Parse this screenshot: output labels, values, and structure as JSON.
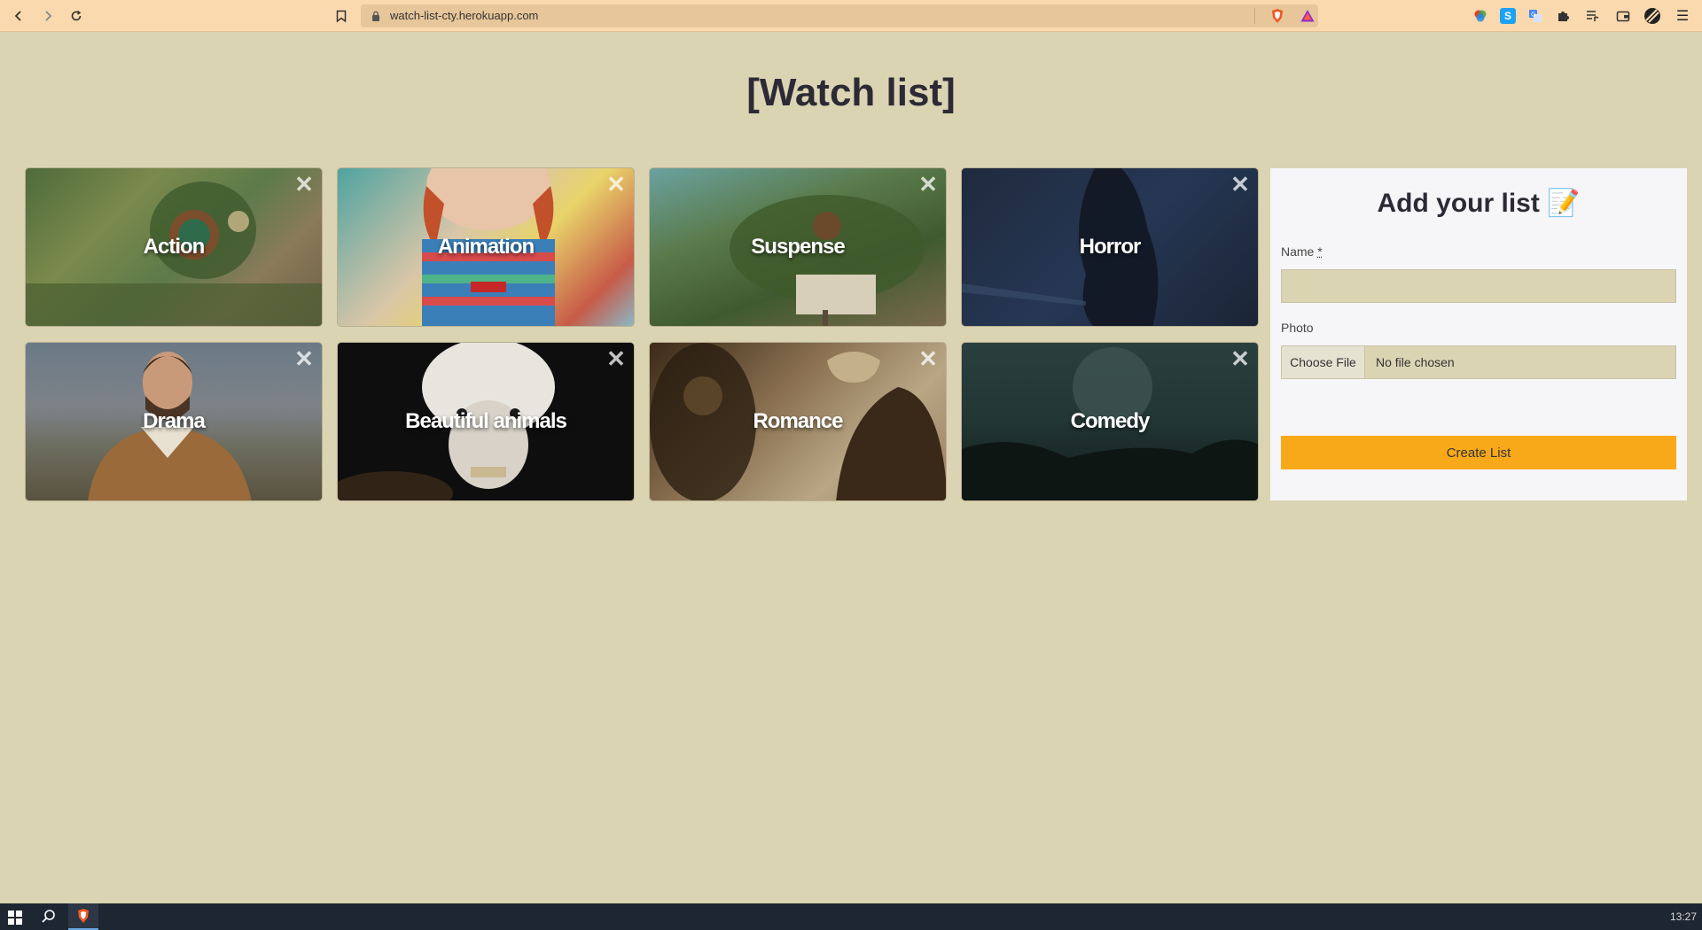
{
  "browser": {
    "url": "watch-list-cty.herokuapp.com",
    "back_icon": "back-icon",
    "forward_icon": "forward-icon",
    "reload_icon": "reload-icon"
  },
  "page": {
    "title": "[Watch list]"
  },
  "cards": [
    {
      "label": "Action",
      "close": "✕"
    },
    {
      "label": "Animation",
      "close": "✕"
    },
    {
      "label": "Suspense",
      "close": "✕"
    },
    {
      "label": "Horror",
      "close": "✕"
    },
    {
      "label": "Drama",
      "close": "✕"
    },
    {
      "label": "Beautiful animals",
      "close": "✕"
    },
    {
      "label": "Romance",
      "close": "✕"
    },
    {
      "label": "Comedy",
      "close": "✕"
    }
  ],
  "form": {
    "title": "Add your list 📝",
    "name_label": "Name",
    "name_required": "*",
    "name_value": "",
    "photo_label": "Photo",
    "file_button": "Choose File",
    "file_status": "No file chosen",
    "submit_label": "Create List"
  },
  "taskbar": {
    "clock": "13:27"
  },
  "colors": {
    "page_bg": "#dbd4b3",
    "chrome_bg": "#fad9ae",
    "accent": "#f8a91a"
  }
}
